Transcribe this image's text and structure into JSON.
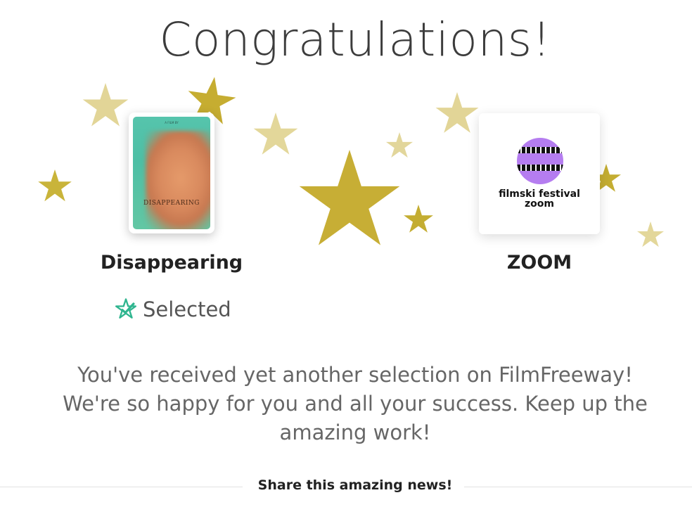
{
  "headline": "Congratulations!",
  "film": {
    "name": "Disappearing",
    "poster_title": "DISAPPEARING",
    "poster_top_text": "A FILM BY"
  },
  "festival": {
    "name": "ZOOM",
    "logo_line1": "filmski festival",
    "logo_line2": "zoom"
  },
  "status": {
    "label": "Selected",
    "icon": "star-check-icon"
  },
  "message": "You've received yet another selection on FilmFreeway! We're so happy for you and all your success. Keep up the amazing work!",
  "share": {
    "label": "Share this amazing news!"
  },
  "colors": {
    "star_dark": "#c4ad35",
    "star_light": "#e3d79a",
    "selected_icon": "#2fb58f",
    "logo_purple": "#b57df0"
  }
}
